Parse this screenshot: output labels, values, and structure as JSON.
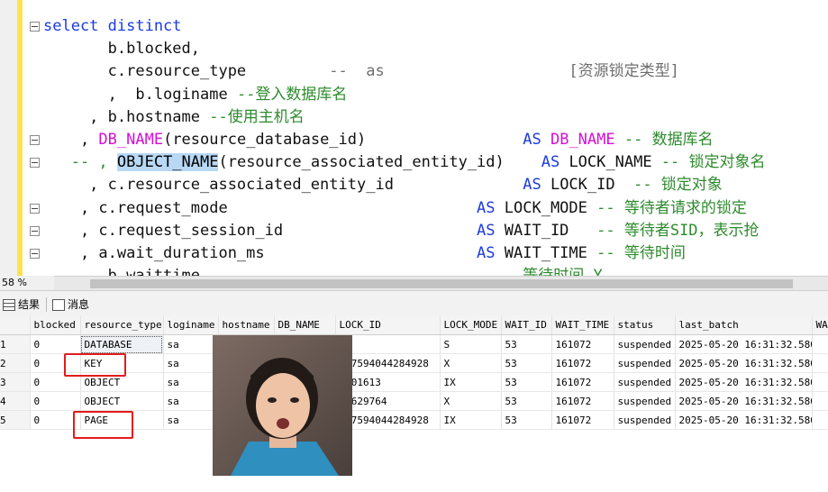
{
  "editor": {
    "lines": [
      [
        {
          "c": "kw",
          "t": "select distinct"
        }
      ],
      [
        {
          "c": "tx",
          "t": "       b.blocked,"
        }
      ],
      [
        {
          "c": "tx",
          "t": "       c.resource_type         "
        },
        {
          "c": "gr",
          "t": "--  as"
        },
        {
          "c": "gr",
          "t": "                    [资源锁定类型]"
        }
      ],
      [
        {
          "c": "tx",
          "t": "       ,  b.loginame "
        },
        {
          "c": "cm",
          "t": "--登入数据库名"
        }
      ],
      [
        {
          "c": "tx",
          "t": "     , b.hostname "
        },
        {
          "c": "cm",
          "t": "--使用主机名"
        }
      ],
      [
        {
          "c": "tx",
          "t": "    , "
        },
        {
          "c": "fn",
          "t": "DB_NAME"
        },
        {
          "c": "tx",
          "t": "(resource_database_id)"
        },
        {
          "c": "tx",
          "t": "                 "
        },
        {
          "c": "kw",
          "t": "AS "
        },
        {
          "c": "fn",
          "t": "DB_NAME"
        },
        {
          "c": "cm",
          "t": " -- 数据库名"
        }
      ],
      [
        {
          "c": "cm",
          "t": "   -- , "
        },
        {
          "c": "hl",
          "t": "OBJECT_NAME"
        },
        {
          "c": "tx",
          "t": "(resource_associated_entity_id)"
        },
        {
          "c": "tx",
          "t": "    "
        },
        {
          "c": "kw",
          "t": "AS "
        },
        {
          "c": "tx",
          "t": "LOCK_NAME"
        },
        {
          "c": "cm",
          "t": " -- 锁定对象名"
        }
      ],
      [
        {
          "c": "tx",
          "t": "     , c.resource_associated_entity_id"
        },
        {
          "c": "tx",
          "t": "              "
        },
        {
          "c": "kw",
          "t": "AS "
        },
        {
          "c": "tx",
          "t": "LOCK_ID"
        },
        {
          "c": "cm",
          "t": "  -- 锁定对象"
        }
      ],
      [
        {
          "c": "tx",
          "t": "    , c.request_mode"
        },
        {
          "c": "tx",
          "t": "                           "
        },
        {
          "c": "kw",
          "t": "AS "
        },
        {
          "c": "tx",
          "t": "LOCK_MODE"
        },
        {
          "c": "cm",
          "t": " -- 等待者请求的锁定"
        }
      ],
      [
        {
          "c": "tx",
          "t": "    , c.request_session_id"
        },
        {
          "c": "tx",
          "t": "                     "
        },
        {
          "c": "kw",
          "t": "AS "
        },
        {
          "c": "tx",
          "t": "WAIT_ID"
        },
        {
          "c": "cm",
          "t": "   -- 等待者SID，表示抢"
        }
      ],
      [
        {
          "c": "tx",
          "t": "    , a.wait_duration_ms"
        },
        {
          "c": "tx",
          "t": "                       "
        },
        {
          "c": "kw",
          "t": "AS "
        },
        {
          "c": "tx",
          "t": "WAIT_TIME"
        },
        {
          "c": "cm",
          "t": " -- 等待时间"
        }
      ],
      [
        {
          "c": "tx",
          "t": "       b.waittime"
        },
        {
          "c": "cm",
          "t": "                                   等待时间 Y"
        }
      ]
    ],
    "zoom": "58 %"
  },
  "tabs": {
    "results": "结果",
    "messages": "消息"
  },
  "grid": {
    "columns": [
      "",
      "blocked",
      "resource_type",
      "loginame",
      "hostname",
      "DB_NAME",
      "LOCK_ID",
      "LOCK_MODE",
      "WAIT_ID",
      "WAIT_TIME",
      "status",
      "last_batch",
      "WA"
    ],
    "rows": [
      [
        "1",
        "0",
        "DATABASE",
        "sa",
        "",
        "",
        "",
        "S",
        "53",
        "161072",
        "suspended",
        "2025-05-20 16:31:32.580",
        ""
      ],
      [
        "2",
        "0",
        "KEY",
        "sa",
        "",
        "",
        "057594044284928",
        "X",
        "53",
        "161072",
        "suspended",
        "2025-05-20 16:31:32.580",
        ""
      ],
      [
        "3",
        "0",
        "OBJECT",
        "sa",
        "",
        "",
        "2101613",
        "IX",
        "53",
        "161072",
        "suspended",
        "2025-05-20 16:31:32.580",
        ""
      ],
      [
        "4",
        "0",
        "OBJECT",
        "sa",
        "",
        "",
        "86629764",
        "X",
        "53",
        "161072",
        "suspended",
        "2025-05-20 16:31:32.580",
        ""
      ],
      [
        "5",
        "0",
        "PAGE",
        "sa",
        "",
        "",
        "057594044284928",
        "IX",
        "53",
        "161072",
        "suspended",
        "2025-05-20 16:31:32.580",
        ""
      ]
    ]
  }
}
